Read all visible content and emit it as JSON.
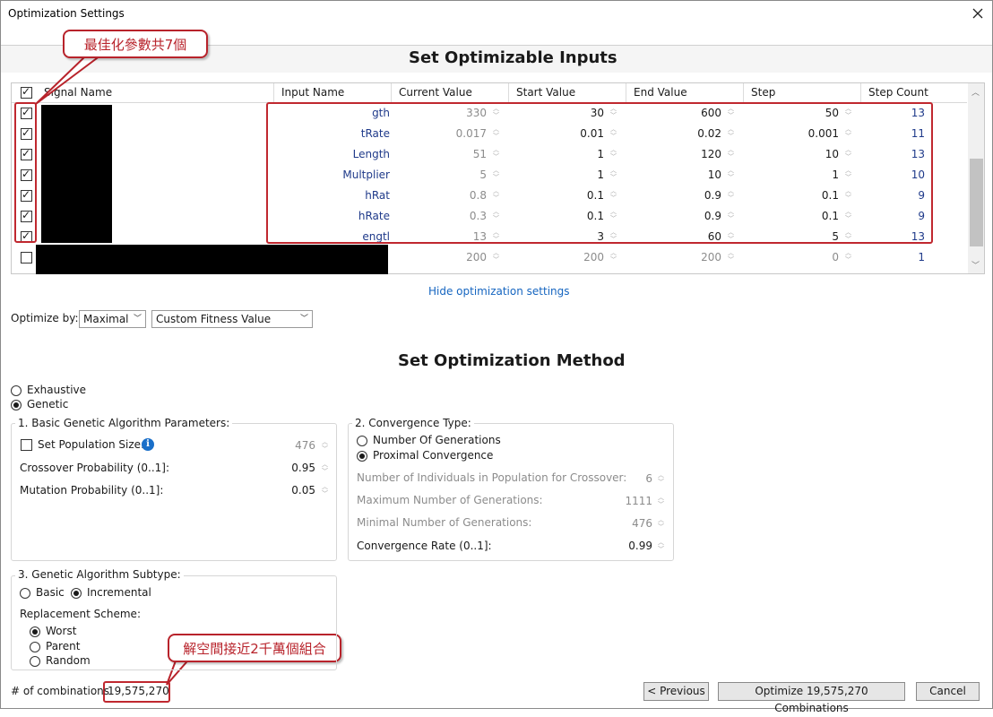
{
  "window": {
    "title": "Optimization Settings",
    "close_icon": "close-icon"
  },
  "sections": {
    "inputs_title": "Set Optimizable Inputs",
    "method_title": "Set Optimization Method"
  },
  "grid": {
    "columns": [
      "Signal Name",
      "Input Name",
      "Current Value",
      "Start Value",
      "End Value",
      "Step",
      "Step Count"
    ],
    "rows": [
      {
        "checked": true,
        "input_suffix": "gth",
        "current": "330",
        "start": "30",
        "end": "600",
        "step": "50",
        "count": "13"
      },
      {
        "checked": true,
        "input_suffix": "tRate",
        "current": "0.017",
        "start": "0.01",
        "end": "0.02",
        "step": "0.001",
        "count": "11"
      },
      {
        "checked": true,
        "input_suffix": "Length",
        "current": "51",
        "start": "1",
        "end": "120",
        "step": "10",
        "count": "13"
      },
      {
        "checked": true,
        "input_suffix": "Multplier",
        "current": "5",
        "start": "1",
        "end": "10",
        "step": "1",
        "count": "10"
      },
      {
        "checked": true,
        "input_suffix": "hRat",
        "current": "0.8",
        "start": "0.1",
        "end": "0.9",
        "step": "0.1",
        "count": "9"
      },
      {
        "checked": true,
        "input_suffix": "hRate",
        "current": "0.3",
        "start": "0.1",
        "end": "0.9",
        "step": "0.1",
        "count": "9"
      },
      {
        "checked": true,
        "input_suffix": "engtl",
        "current": "13",
        "start": "3",
        "end": "60",
        "step": "5",
        "count": "13"
      },
      {
        "checked": false,
        "input_suffix": "",
        "current": "200",
        "start": "200",
        "end": "200",
        "step": "0",
        "count": "1"
      }
    ]
  },
  "annotations": {
    "params_callout": "最佳化參數共7個",
    "space_callout": "解空間接近2千萬個組合"
  },
  "hide_link": "Hide optimization settings",
  "optimize_by": {
    "label": "Optimize by:",
    "mode": "Maximal",
    "target": "Custom Fitness Value"
  },
  "method": {
    "exhaustive": "Exhaustive",
    "genetic": "Genetic",
    "selected": "genetic"
  },
  "basic_params": {
    "title": "1. Basic Genetic Algorithm Parameters:",
    "population_label": "Set Population Size:",
    "population_value": "476",
    "crossover_label": "Crossover Probability (0..1]:",
    "crossover_value": "0.95",
    "mutation_label": "Mutation Probability (0..1]:",
    "mutation_value": "0.05"
  },
  "convergence": {
    "title": "2. Convergence Type:",
    "opt_generations": "Number Of Generations",
    "opt_proximal": "Proximal Convergence",
    "individuals_label": "Number of Individuals in Population for Crossover:",
    "individuals_value": "6",
    "max_gen_label": "Maximum Number of Generations:",
    "max_gen_value": "1111",
    "min_gen_label": "Minimal Number of Generations:",
    "min_gen_value": "476",
    "rate_label": "Convergence Rate (0..1]:",
    "rate_value": "0.99"
  },
  "subtype": {
    "title": "3. Genetic Algorithm Subtype:",
    "basic": "Basic",
    "incremental": "Incremental",
    "replacement_label": "Replacement Scheme:",
    "worst": "Worst",
    "parent": "Parent",
    "random": "Random"
  },
  "footer": {
    "combinations_label": "# of combinations",
    "combinations_value": "19,575,270",
    "previous_button": "< Previous",
    "optimize_button": "Optimize 19,575,270 Combinations",
    "cancel_button": "Cancel"
  },
  "colors": {
    "accent_red": "#c0282f",
    "link_blue": "#1565c0",
    "value_blue": "#1f3a8a"
  }
}
